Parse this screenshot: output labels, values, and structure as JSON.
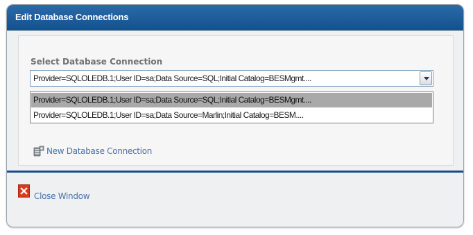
{
  "window": {
    "title": "Edit Database Connections"
  },
  "connection_select": {
    "label": "Select Database Connection",
    "selected_value": "Provider=SQLOLEDB.1;User ID=sa;Data Source=SQL;Initial Catalog=BESMgmt....",
    "options": [
      {
        "label": "Provider=SQLOLEDB.1;User ID=sa;Data Source=SQL;Initial Catalog=BESMgmt....",
        "highlighted": true
      },
      {
        "label": "Provider=SQLOLEDB.1;User ID=sa;Data Source=Marlin;Initial Catalog=BESM....",
        "highlighted": false
      }
    ]
  },
  "actions": {
    "new_connection_label": "New Database Connection",
    "new_connection_icon": "database-add-icon",
    "close_label": "Close Window",
    "close_icon": "close-icon"
  },
  "colors": {
    "title_bar": "#14528f",
    "link": "#4a73a8",
    "highlight": "#a9a9a9",
    "close_icon": "#d93a1c"
  }
}
